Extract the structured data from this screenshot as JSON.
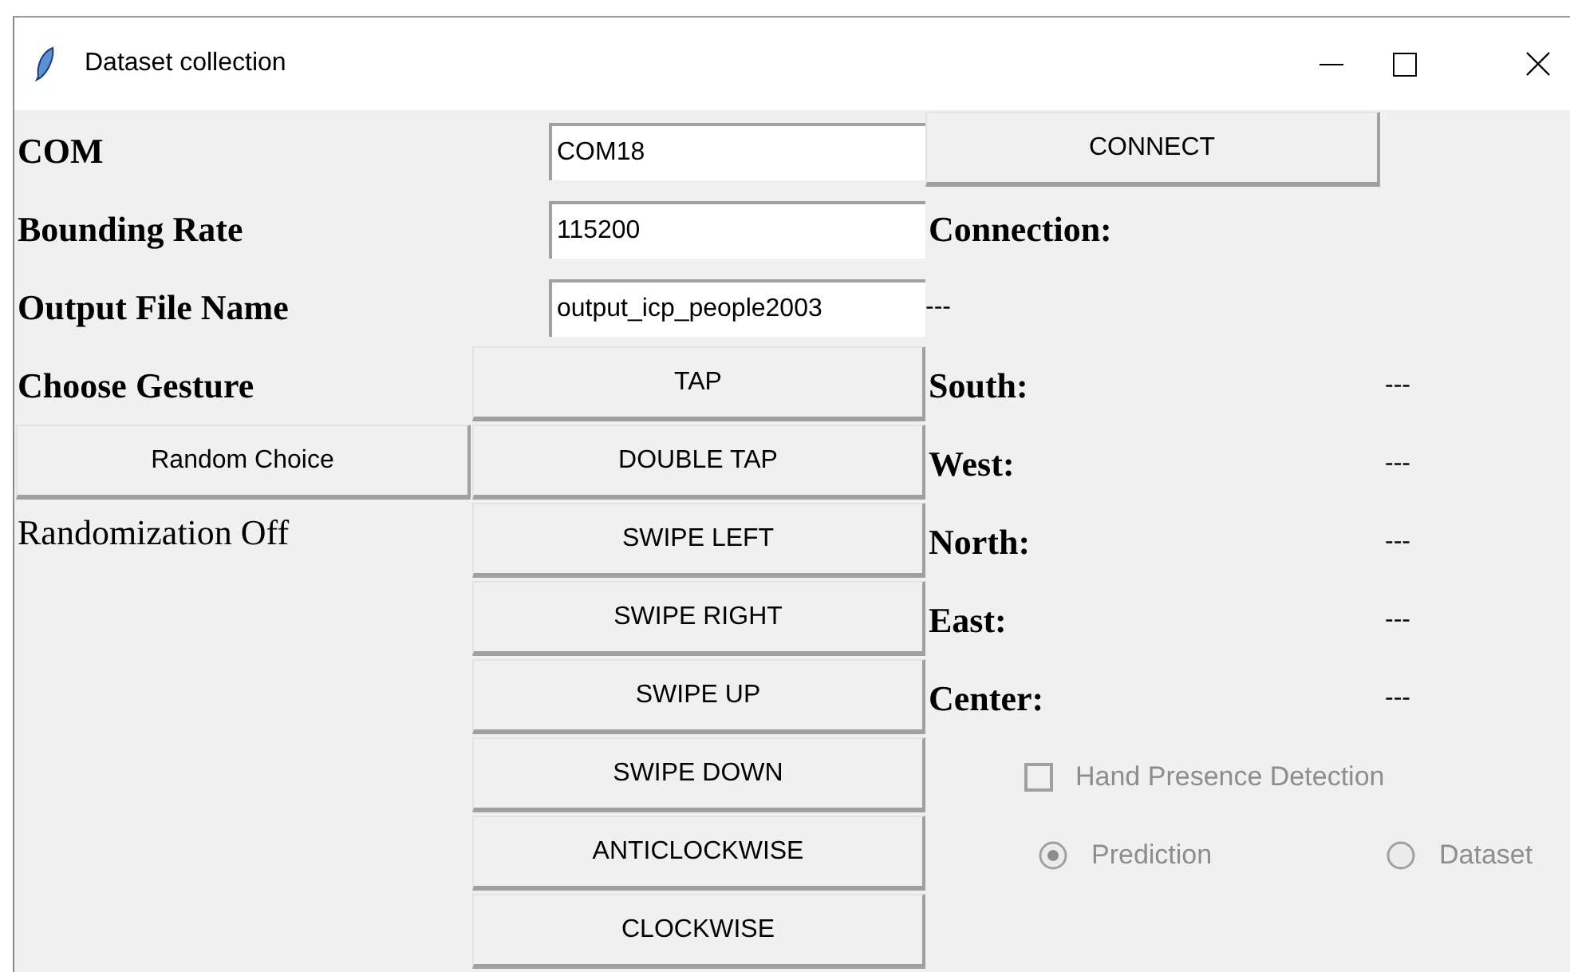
{
  "window": {
    "title": "Dataset collection"
  },
  "form_rows": [
    {
      "label": "COM",
      "value": "COM18"
    },
    {
      "label": "Bounding Rate",
      "value": "115200"
    },
    {
      "label": "Output File Name",
      "value": "output_icp_people2003"
    }
  ],
  "connect_button": "CONNECT",
  "connection": {
    "label": "Connection:",
    "value": "---"
  },
  "choose_gesture_label": "Choose Gesture",
  "gesture_buttons": [
    "TAP",
    "DOUBLE TAP",
    "SWIPE LEFT",
    "SWIPE RIGHT",
    "SWIPE UP",
    "SWIPE DOWN",
    "ANTICLOCKWISE",
    "CLOCKWISE"
  ],
  "random_choice_button": "Random Choice",
  "randomization_status": "Randomization Off",
  "readings": [
    {
      "label": "South:",
      "value": "---"
    },
    {
      "label": "West:",
      "value": "---"
    },
    {
      "label": "North:",
      "value": "---"
    },
    {
      "label": "East:",
      "value": "---"
    },
    {
      "label": "Center:",
      "value": "---"
    }
  ],
  "hand_presence": {
    "label": "Hand Presence Detection",
    "checked": false,
    "disabled": true
  },
  "mode_radios": [
    {
      "label": "Prediction",
      "selected": true,
      "disabled": true
    },
    {
      "label": "Dataset",
      "selected": false,
      "disabled": true
    }
  ]
}
